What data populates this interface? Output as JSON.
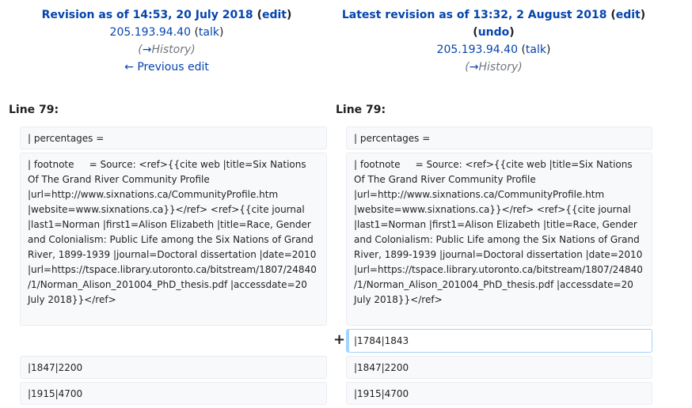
{
  "left_header": {
    "title_prefix": "Revision as of 14:53, 20 July 2018",
    "edit_label": "edit",
    "user": "205.193.94.40",
    "talk_label": "talk",
    "comment_arrow": "→",
    "comment_section": "History",
    "prev_edit_label": "← Previous edit"
  },
  "right_header": {
    "title_prefix": "Latest revision as of 13:32, 2 August 2018",
    "edit_label": "edit",
    "undo_label": "undo",
    "user": "205.193.94.40",
    "talk_label": "talk",
    "comment_arrow": "→",
    "comment_section": "History"
  },
  "left_lineno": "Line 79:",
  "right_lineno": "Line 79:",
  "diff_rows": {
    "context1": "| percentages =",
    "footnote": "| footnote     = Source: <ref>{{cite web |title=Six Nations Of The Grand River Community Profile |url=http://www.sixnations.ca/CommunityProfile.htm |website=www.sixnations.ca}}</ref> <ref>{{cite journal |last1=Norman |first1=Alison Elizabeth |title=Race, Gender and Colonialism: Public Life among the Six Nations of Grand River, 1899-1939 |journal=Doctoral dissertation |date=2010 |url=https://tspace.library.utoronto.ca/bitstream/1807/24840/1/Norman_Alison_201004_PhD_thesis.pdf |accessdate=20 July 2018}}</ref>",
    "added_marker": "+",
    "added_line": "|1784|1843",
    "context2": "|1847|2200",
    "context3": "|1915|4700"
  }
}
